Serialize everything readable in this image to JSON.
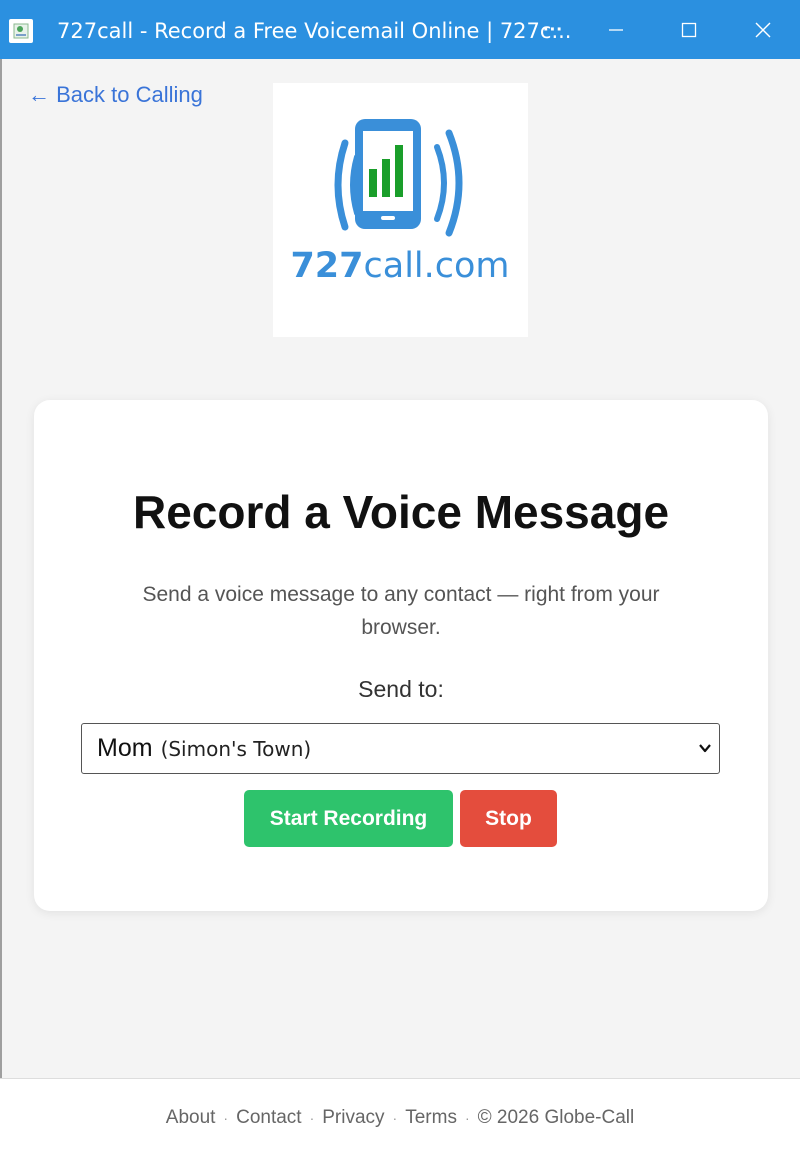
{
  "window": {
    "title": "727call - Record a Free Voicemail Online | 727c...",
    "more_glyph": "···"
  },
  "nav": {
    "back_label": "← Back to Calling"
  },
  "logo": {
    "text_number": "727",
    "text_rest": "call.com",
    "icon": "phone-signal-icon",
    "colors": {
      "blue": "#3a8fd9",
      "green": "#1a9e2a"
    }
  },
  "card": {
    "title": "Record a Voice Message",
    "description": "Send a voice message to any contact — right from your browser.",
    "send_to_label": "Send to:",
    "select": {
      "name": "Mom",
      "place": "(Simon's Town)"
    },
    "buttons": {
      "start": "Start Recording",
      "stop": "Stop"
    }
  },
  "footer": {
    "links": [
      "About",
      "Contact",
      "Privacy",
      "Terms"
    ],
    "copyright": "© 2026 Globe-Call"
  },
  "colors": {
    "titlebar": "#2b90e0",
    "link": "#3a74d8",
    "start_button": "#2ec36c",
    "stop_button": "#e44d3d"
  }
}
